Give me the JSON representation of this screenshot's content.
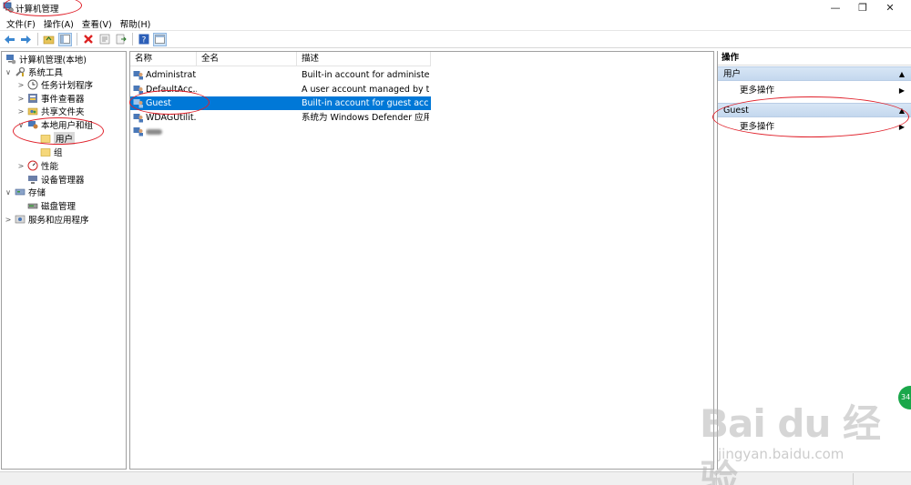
{
  "window": {
    "title": "计算机管理",
    "controls": {
      "minimize": "—",
      "maximize": "❐",
      "close": "✕"
    }
  },
  "menu": [
    {
      "label": "文件(F)"
    },
    {
      "label": "操作(A)"
    },
    {
      "label": "查看(V)"
    },
    {
      "label": "帮助(H)"
    }
  ],
  "toolbar": {
    "icons": [
      "back-icon",
      "forward-icon",
      "up-folder-icon",
      "show-hide-tree-icon",
      "delete-icon",
      "properties-icon",
      "export-icon",
      "help-icon",
      "show-hide-action-icon"
    ]
  },
  "tree": {
    "items": [
      {
        "label": "计算机管理(本地)",
        "level": 0,
        "expander": "",
        "icon": "computer-management-icon"
      },
      {
        "label": "系统工具",
        "level": 0,
        "expander": "∨",
        "icon": "system-tools-icon"
      },
      {
        "label": "任务计划程序",
        "level": 1,
        "expander": ">",
        "icon": "clock-icon"
      },
      {
        "label": "事件查看器",
        "level": 1,
        "expander": ">",
        "icon": "event-viewer-icon"
      },
      {
        "label": "共享文件夹",
        "level": 1,
        "expander": ">",
        "icon": "shared-folder-icon"
      },
      {
        "label": "本地用户和组",
        "level": 1,
        "expander": "∨",
        "icon": "users-group-icon"
      },
      {
        "label": "用户",
        "level": 2,
        "expander": "",
        "icon": "folder-icon",
        "selected": true
      },
      {
        "label": "组",
        "level": 2,
        "expander": "",
        "icon": "folder-icon"
      },
      {
        "label": "性能",
        "level": 1,
        "expander": ">",
        "icon": "performance-icon"
      },
      {
        "label": "设备管理器",
        "level": 1,
        "expander": "",
        "icon": "device-manager-icon"
      },
      {
        "label": "存储",
        "level": 0,
        "expander": "∨",
        "icon": "storage-icon"
      },
      {
        "label": "磁盘管理",
        "level": 1,
        "expander": "",
        "icon": "disk-icon"
      },
      {
        "label": "服务和应用程序",
        "level": 0,
        "expander": ">",
        "icon": "services-icon"
      }
    ]
  },
  "list": {
    "columns": [
      {
        "label": "名称"
      },
      {
        "label": "全名"
      },
      {
        "label": "描述"
      }
    ],
    "rows": [
      {
        "name": "Administrat...",
        "fullname": "",
        "description": "Built-in account for administeri..."
      },
      {
        "name": "DefaultAcc...",
        "fullname": "",
        "description": "A user account managed by th..."
      },
      {
        "name": "Guest",
        "fullname": "",
        "description": "Built-in account for guest acce...",
        "selected": true
      },
      {
        "name": "WDAGUtilit...",
        "fullname": "",
        "description": "系统为 Windows Defender 应用..."
      },
      {
        "name": "",
        "fullname": "",
        "description": "",
        "blurred": true
      }
    ]
  },
  "actions": {
    "title": "操作",
    "sections": [
      {
        "label": "用户",
        "item": "更多操作"
      },
      {
        "label": "Guest",
        "item": "更多操作"
      }
    ]
  },
  "watermark": {
    "logo": "Bai du 经验",
    "url": "jingyan.baidu.com",
    "badge": "34"
  },
  "colors": {
    "selection": "#0078d7",
    "annotation": "#e0202a",
    "section_header": "#c4d8ee"
  }
}
